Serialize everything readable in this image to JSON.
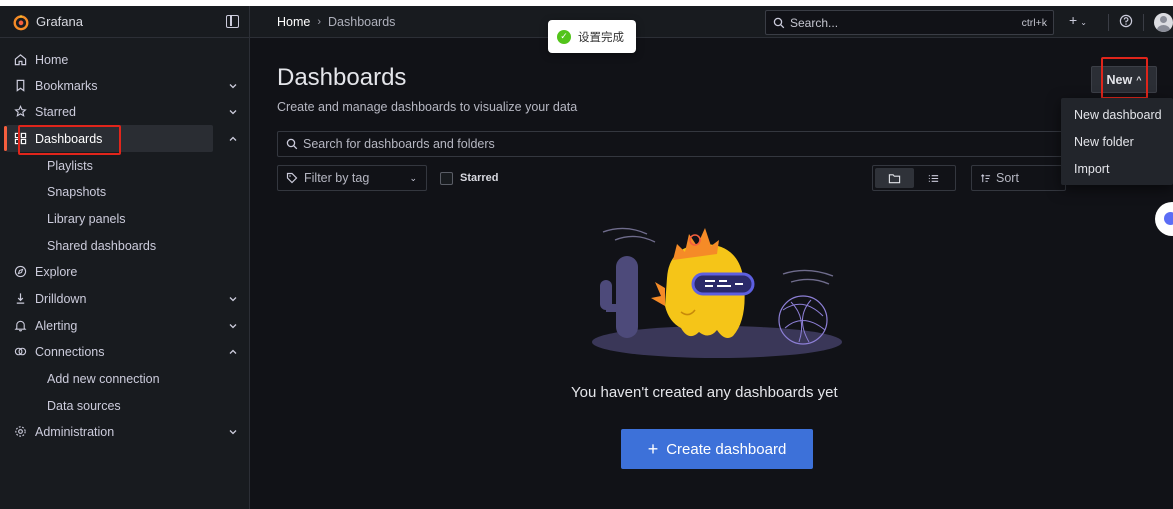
{
  "app": {
    "brand_name": "Grafana",
    "colors": {
      "accent": "#f55f3e",
      "primary": "#3d71d9",
      "highlight": "#e0251b"
    }
  },
  "sidebar": {
    "items": [
      {
        "label": "Home",
        "icon": "home-icon"
      },
      {
        "label": "Bookmarks",
        "icon": "bookmark-icon",
        "expand": "down"
      },
      {
        "label": "Starred",
        "icon": "star-icon",
        "expand": "down"
      },
      {
        "label": "Dashboards",
        "icon": "dashboards-grid-icon",
        "expand": "up",
        "active": true
      },
      {
        "label": "Explore",
        "icon": "compass-icon"
      },
      {
        "label": "Drilldown",
        "icon": "drilldown-icon",
        "expand": "down"
      },
      {
        "label": "Alerting",
        "icon": "bell-icon",
        "expand": "down"
      },
      {
        "label": "Connections",
        "icon": "connections-icon",
        "expand": "up"
      },
      {
        "label": "Administration",
        "icon": "cog-icon",
        "expand": "down"
      }
    ],
    "dashboards_sub": [
      "Playlists",
      "Snapshots",
      "Library panels",
      "Shared dashboards"
    ],
    "connections_sub": [
      "Add new connection",
      "Data sources"
    ]
  },
  "header": {
    "breadcrumb": [
      "Home",
      "Dashboards"
    ],
    "search_placeholder": "Search...",
    "search_shortcut": "ctrl+k",
    "add_label": "+"
  },
  "toast": {
    "message": "设置完成"
  },
  "main": {
    "title": "Dashboards",
    "subtitle": "Create and manage dashboards to visualize your data",
    "new_button": "New",
    "search_placeholder": "Search for dashboards and folders",
    "filter_by_tag": "Filter by tag",
    "starred_label": "Starred",
    "sort_label": "Sort",
    "empty_message": "You haven't created any dashboards yet",
    "create_button": "Create dashboard"
  },
  "new_menu": {
    "items": [
      "New dashboard",
      "New folder",
      "Import"
    ]
  }
}
